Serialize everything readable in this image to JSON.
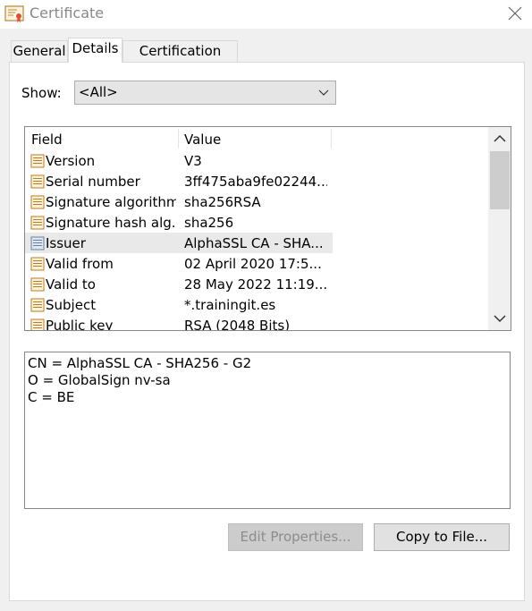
{
  "window": {
    "title": "Certificate",
    "icon": "certificate-icon"
  },
  "tabs": [
    {
      "label": "General",
      "active": false
    },
    {
      "label": "Details",
      "active": true
    },
    {
      "label": "Certification Path",
      "active": false
    }
  ],
  "show": {
    "label": "Show:",
    "selected": "<All>"
  },
  "list": {
    "headers": {
      "field": "Field",
      "value": "Value"
    },
    "rows": [
      {
        "field": "Version",
        "value": "V3",
        "selected": false
      },
      {
        "field": "Serial number",
        "value": "3ff475aba9fe02244...",
        "selected": false
      },
      {
        "field": "Signature algorithm",
        "value": "sha256RSA",
        "selected": false
      },
      {
        "field": "Signature hash alg...",
        "value": "sha256",
        "selected": false
      },
      {
        "field": "Issuer",
        "value": "AlphaSSL CA - SHA...",
        "selected": true
      },
      {
        "field": "Valid from",
        "value": "02 April 2020 17:5...",
        "selected": false
      },
      {
        "field": "Valid to",
        "value": "28 May 2022 11:19...",
        "selected": false
      },
      {
        "field": "Subject",
        "value": "*.trainingit.es",
        "selected": false
      },
      {
        "field": "Public key",
        "value": "RSA (2048 Bits)",
        "selected": false
      }
    ]
  },
  "detail": {
    "lines": [
      "CN = AlphaSSL CA - SHA256 - G2",
      "O = GlobalSign nv-sa",
      "C = BE"
    ]
  },
  "buttons": {
    "edit_properties": "Edit Properties...",
    "copy_to_file": "Copy to File..."
  },
  "colors": {
    "dialog_bg": "#f0f0f0",
    "selected_row": "#e9e9e9",
    "disabled_text": "#8c8c8c"
  }
}
